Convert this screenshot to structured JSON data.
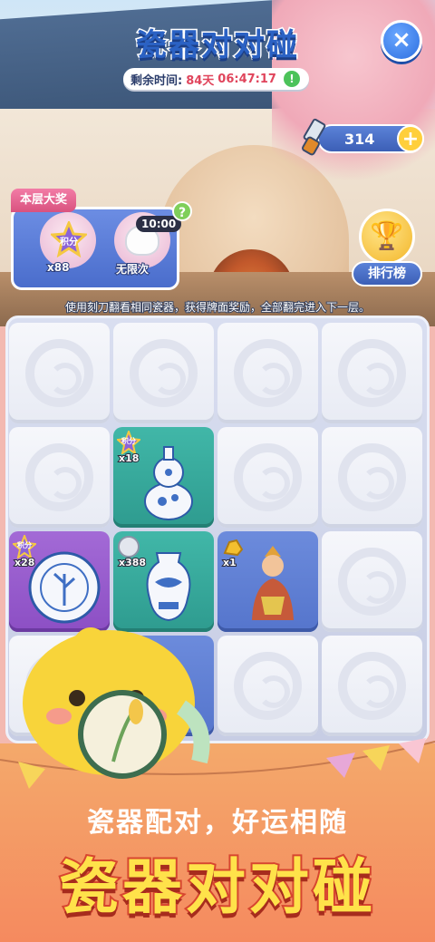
{
  "header": {
    "title": "瓷器对对碰",
    "timer_label": "剩余时间:",
    "timer_days": "84天",
    "timer_clock": "06:47:17",
    "timer_alert": "!",
    "close_label": "×"
  },
  "currency": {
    "value": "314",
    "plus": "+"
  },
  "reward": {
    "tag": "本层大奖",
    "time_badge": "10:00",
    "help": "?",
    "item_a_label": "x88",
    "item_a_text": "积分",
    "item_b_label": "无限次"
  },
  "ranking": {
    "label": "排行榜"
  },
  "hint": "使用刻刀翻看相同瓷器，获得牌面奖励，全部翻完进入下一层。",
  "grid": {
    "tiles": [
      {
        "state": "closed"
      },
      {
        "state": "closed"
      },
      {
        "state": "closed"
      },
      {
        "state": "closed"
      },
      {
        "state": "closed"
      },
      {
        "state": "open",
        "color": "teal",
        "badge": "积分",
        "count": "x18",
        "object": "gourd-vase"
      },
      {
        "state": "closed"
      },
      {
        "state": "closed"
      },
      {
        "state": "open",
        "color": "purple",
        "badge": "积分",
        "count": "x28",
        "object": "plate"
      },
      {
        "state": "open",
        "color": "teal",
        "badge": "coin",
        "count": "x388",
        "object": "jar"
      },
      {
        "state": "open",
        "color": "blue",
        "badge": "gold",
        "count": "x1",
        "object": "figurine"
      },
      {
        "state": "closed"
      },
      {
        "state": "closed"
      },
      {
        "state": "open",
        "color": "blue",
        "badge": "",
        "count": "",
        "object": ""
      },
      {
        "state": "closed"
      },
      {
        "state": "closed"
      }
    ]
  },
  "footer": {
    "slogan": "瓷器配对，好运相随",
    "title": "瓷器对对碰"
  },
  "colors": {
    "accent_blue": "#3c5fb6",
    "title_yellow": "#ffe24a",
    "title_red": "#d7462f"
  }
}
